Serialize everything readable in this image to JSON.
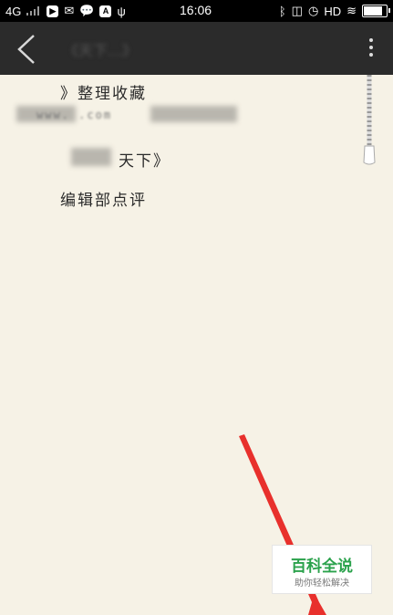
{
  "status_bar": {
    "network": "4G",
    "time": "16:06",
    "a_icon_label": "A",
    "hd": "HD"
  },
  "toolbar": {
    "title": "《天下…》"
  },
  "content": {
    "line1": "》整理收藏",
    "line2": "www.                .com",
    "line3": "天下》",
    "line4": "编辑部点评"
  },
  "watermark": {
    "title": "百科全说",
    "subtitle": "助你轻松解决"
  },
  "colors": {
    "toolbar": "#2b2b2b",
    "paper": "#f6f2e6",
    "arrow": "#e8302c",
    "watermark_green": "#2ba24c"
  }
}
